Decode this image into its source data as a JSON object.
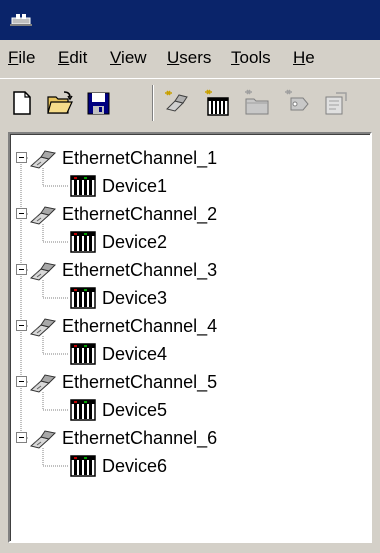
{
  "menubar": {
    "items": [
      {
        "label": "File",
        "acc": "F",
        "rest": "ile"
      },
      {
        "label": "Edit",
        "acc": "E",
        "rest": "dit"
      },
      {
        "label": "View",
        "acc": "V",
        "rest": "iew"
      },
      {
        "label": "Users",
        "acc": "U",
        "rest": "sers"
      },
      {
        "label": "Tools",
        "acc": "T",
        "rest": "ools"
      },
      {
        "label": "He",
        "acc": "H",
        "rest": "e"
      }
    ]
  },
  "toolbar": {
    "buttons": [
      "new-icon",
      "open-icon",
      "save-icon",
      "new-channel-icon",
      "new-device-icon",
      "new-tag-group-icon",
      "new-tag-icon",
      "properties-icon"
    ]
  },
  "tree": {
    "channels": [
      {
        "label": "EthernetChannel_1",
        "device": "Device1"
      },
      {
        "label": "EthernetChannel_2",
        "device": "Device2"
      },
      {
        "label": "EthernetChannel_3",
        "device": "Device3"
      },
      {
        "label": "EthernetChannel_4",
        "device": "Device4"
      },
      {
        "label": "EthernetChannel_5",
        "device": "Device5"
      },
      {
        "label": "EthernetChannel_6",
        "device": "Device6"
      }
    ]
  },
  "colors": {
    "titlebar": "#0a246a",
    "face": "#d4d0c8",
    "tree_background": "#ffffff"
  }
}
